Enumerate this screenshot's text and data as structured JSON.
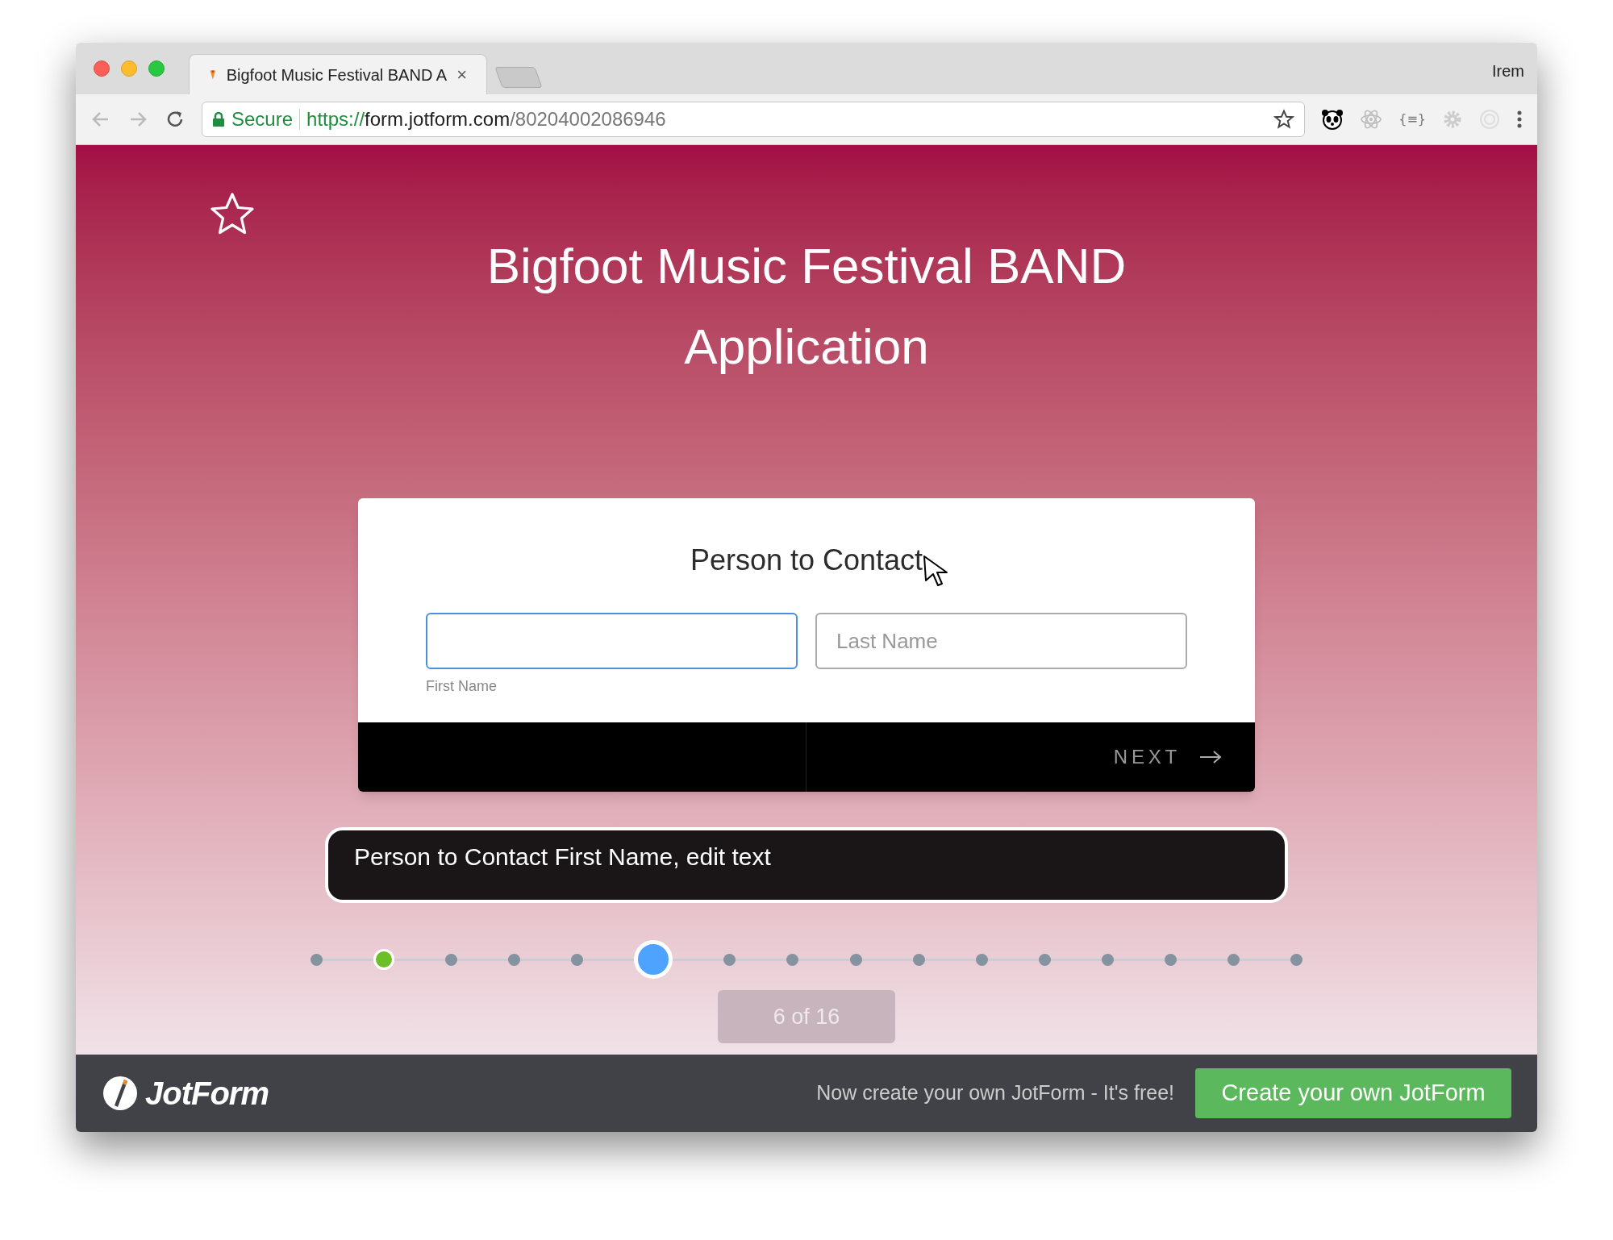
{
  "browser": {
    "tab_title": "Bigfoot Music Festival BAND A",
    "tab_close": "×",
    "profile": "Irem",
    "secure_label": "Secure",
    "url_scheme": "https://",
    "url_host": "form.jotform.com",
    "url_path": "/80204002086946",
    "extension_text": "{≡}"
  },
  "form": {
    "title": "Bigfoot Music Festival BAND Application",
    "question": "Person to Contact",
    "fields": [
      {
        "label": "First Name",
        "focused": true
      },
      {
        "placeholder": "Last Name",
        "focused": false
      }
    ],
    "next_button": "NEXT",
    "tooltip": "Person to Contact First Name, edit text",
    "steps": [
      {
        "completed": false,
        "selected": false
      },
      {
        "completed": true,
        "selected": false
      },
      {
        "completed": false,
        "selected": false
      },
      {
        "completed": false,
        "selected": false
      },
      {
        "completed": false,
        "selected": false
      },
      {
        "completed": false,
        "selected": true
      },
      {
        "completed": false,
        "selected": false
      },
      {
        "completed": false,
        "selected": false
      },
      {
        "completed": false,
        "selected": false
      },
      {
        "completed": false,
        "selected": false
      },
      {
        "completed": false,
        "selected": false
      },
      {
        "completed": false,
        "selected": false
      },
      {
        "completed": false,
        "selected": false
      },
      {
        "completed": false,
        "selected": false
      },
      {
        "completed": false,
        "selected": false
      },
      {
        "completed": false,
        "selected": false
      }
    ],
    "counter": "6 of 16"
  },
  "footer": {
    "logo": "JotForm",
    "promo": "Now create your own JotForm - It's free!",
    "button": "Create your own JotForm"
  }
}
